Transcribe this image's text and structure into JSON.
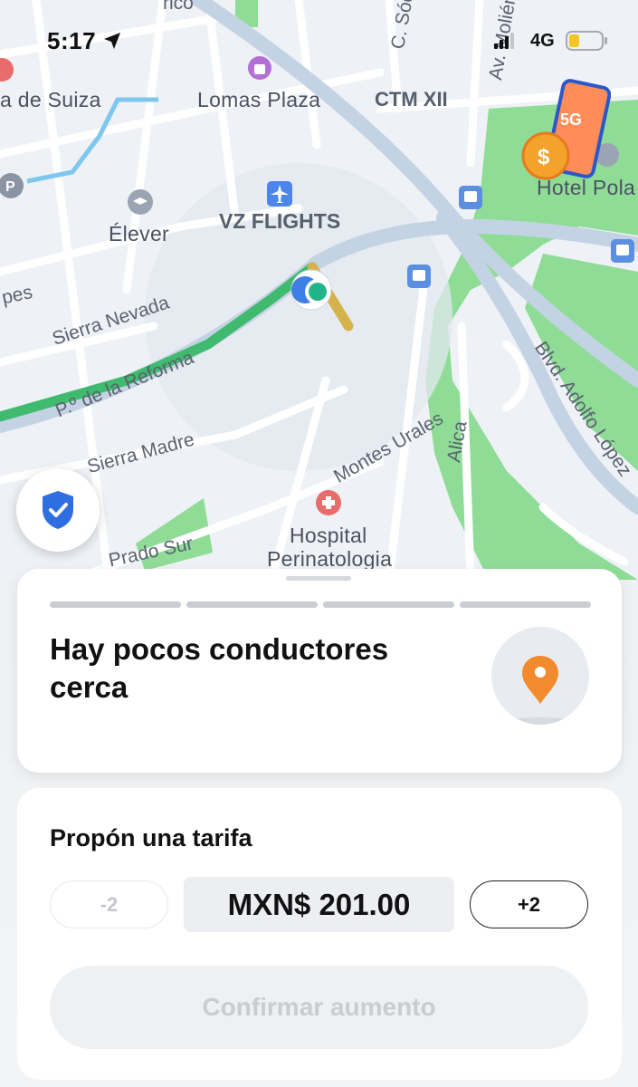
{
  "status_bar": {
    "time": "5:17",
    "network": "4G",
    "icons": [
      "location-arrow-icon",
      "signal-icon",
      "battery-low-icon"
    ]
  },
  "map": {
    "labels": {
      "cico": "rico",
      "c_sod": "C. Sóc",
      "av_moliere": "Av. Moliér",
      "de_suiza": "a de Suiza",
      "lomas_plaza": "Lomas Plaza",
      "ctm_xii": "CTM XII",
      "hotel_pola": "Hotel Pola",
      "elever": "Élever",
      "vz_flights": "VZ FLIGHTS",
      "pes": "pes",
      "sierra_nevada": "Sierra Nevada",
      "paseo_reforma": "P.º de la Reforma",
      "blvd_adolfo": "Blvd. Adolfo López",
      "sierra_madre": "Sierra Madre",
      "montes_urales": "Montes Urales",
      "alica": "Alica",
      "hospital": "Hospital",
      "perinatologia": "Perinatologia",
      "prado_sur": "Prado Sur"
    },
    "promo_badge": "5G",
    "colors": {
      "route": "#3fba6e",
      "park": "#8fdc97",
      "road": "#c4d3e3"
    }
  },
  "safety": {
    "icon": "shield-check-icon"
  },
  "drivers_card": {
    "progress_segments": 4,
    "title": "Hay pocos conductores cerca",
    "icon": "location-pin-icon"
  },
  "fare_card": {
    "label": "Propón una tarifa",
    "decrease_label": "-2",
    "fare_value": "MXN$ 201.00",
    "increase_label": "+2",
    "confirm_label": "Confirmar aumento"
  }
}
